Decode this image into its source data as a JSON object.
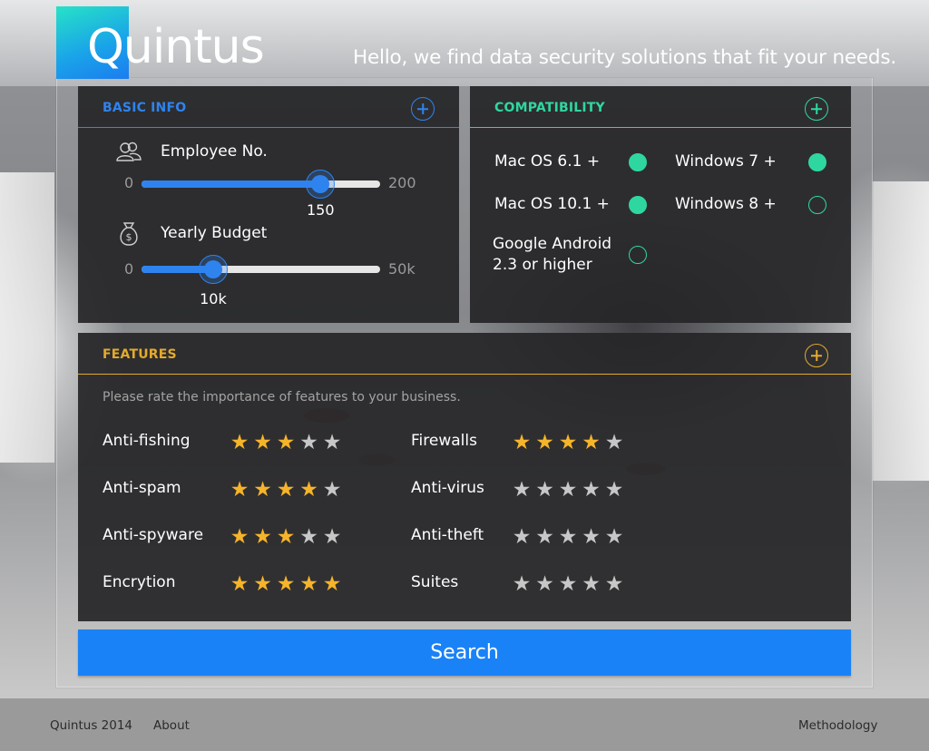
{
  "brand": {
    "name": "Quintus",
    "tagline": "Hello, we find data security solutions that fit your needs."
  },
  "basic_info": {
    "title": "BASIC INFO",
    "employee": {
      "label": "Employee No.",
      "min": "0",
      "max": "200",
      "value": "150",
      "fraction": 0.75,
      "icon": "people-icon"
    },
    "budget": {
      "label": "Yearly Budget",
      "min": "0",
      "max": "50k",
      "value": "10k",
      "fraction": 0.3,
      "icon": "money-bag-icon"
    }
  },
  "compatibility": {
    "title": "COMPATIBILITY",
    "items": [
      {
        "label": "Mac OS 6.1 +",
        "checked": true
      },
      {
        "label": "Windows 7 +",
        "checked": true
      },
      {
        "label": "Mac OS 10.1 +",
        "checked": true
      },
      {
        "label": "Windows 8 +",
        "checked": false
      },
      {
        "label": "Google Android\n2.3 or higher",
        "checked": false
      }
    ]
  },
  "features": {
    "title": "FEATURES",
    "hint": "Please rate the importance of features to your business.",
    "left": [
      {
        "name": "Anti-fishing",
        "rating": 3
      },
      {
        "name": "Anti-spam",
        "rating": 4
      },
      {
        "name": "Anti-spyware",
        "rating": 3
      },
      {
        "name": "Encrytion",
        "rating": 5
      }
    ],
    "right": [
      {
        "name": "Firewalls",
        "rating": 4
      },
      {
        "name": "Anti-virus",
        "rating": 0
      },
      {
        "name": "Anti-theft",
        "rating": 0
      },
      {
        "name": "Suites",
        "rating": 0
      }
    ],
    "max_rating": 5
  },
  "search_label": "Search",
  "footer": {
    "copyright": "Quintus 2014",
    "about": "About",
    "methodology": "Methodology"
  },
  "colors": {
    "blue": "#2f83ee",
    "green": "#2fd7a0",
    "gold": "#e4aa2c",
    "button": "#1a82f7"
  }
}
